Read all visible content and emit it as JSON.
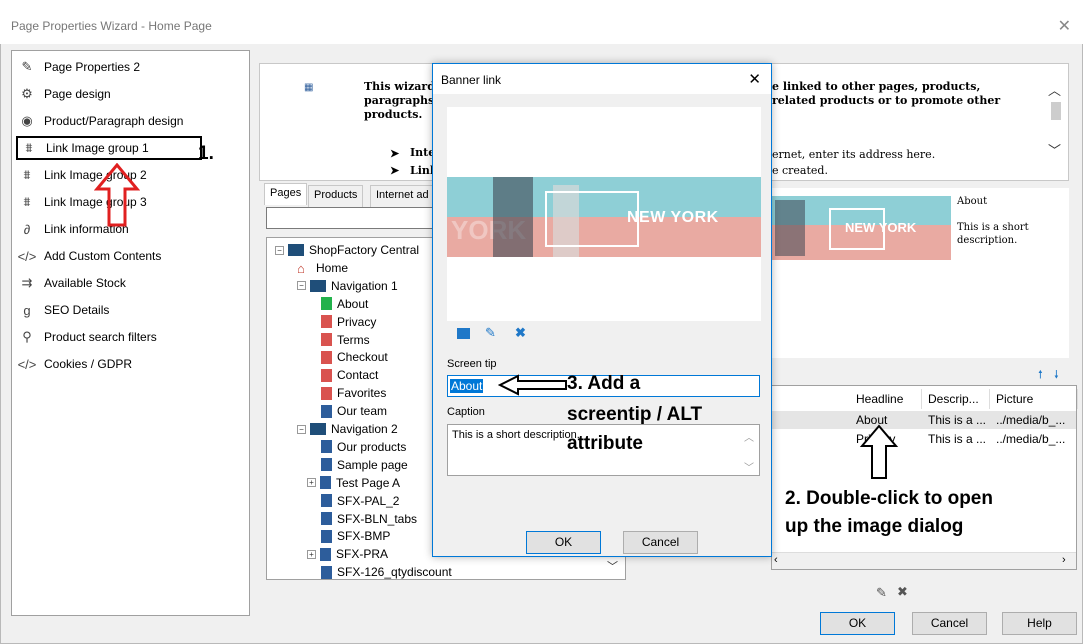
{
  "window": {
    "title": "Page Properties Wizard - Home Page",
    "close_glyph": "✕"
  },
  "left_nav": {
    "items": [
      {
        "label": "Page Properties 2",
        "icon": "pencil-icon",
        "glyph": "✎"
      },
      {
        "label": "Page design",
        "icon": "palette-icon",
        "glyph": "⚙"
      },
      {
        "label": "Product/Paragraph design",
        "icon": "eye-icon",
        "glyph": "◉"
      },
      {
        "label": "Link Image group 1",
        "icon": "sitemap-icon",
        "glyph": "⩩"
      },
      {
        "label": "Link Image group 2",
        "icon": "sitemap-icon",
        "glyph": "⩩"
      },
      {
        "label": "Link Image group 3",
        "icon": "sitemap-icon",
        "glyph": "⩩"
      },
      {
        "label": "Link information",
        "icon": "link-icon",
        "glyph": "∂"
      },
      {
        "label": "Add Custom Contents",
        "icon": "code-icon",
        "glyph": "</>"
      },
      {
        "label": "Available Stock",
        "icon": "stock-icon",
        "glyph": "⇉"
      },
      {
        "label": "SEO Details",
        "icon": "seo-icon",
        "glyph": "g"
      },
      {
        "label": "Product search filters",
        "icon": "search-icon",
        "glyph": "⚲"
      },
      {
        "label": "Cookies / GDPR",
        "icon": "code-icon",
        "glyph": "</>"
      }
    ]
  },
  "annotations": {
    "step1": "1.",
    "step2_line1": "2. Double-click to open",
    "step2_line2": "up the image dialog",
    "step3_line1": "3. Add a",
    "step3_line2": "screentip / ALT",
    "step3_line3": "attribute"
  },
  "wizard_info": {
    "intro_a": "This wizard",
    "intro_b": "paragraphs",
    "intro_c": "products.",
    "intro_right_a": "e linked to other pages, products,",
    "intro_right_b": "related products or to promote other",
    "bullet1": "Inte",
    "bullet2": "Link",
    "bullet1_right": "ernet, enter its address here.",
    "bullet2_right": "e created."
  },
  "tabs": [
    "Pages",
    "Products",
    "Internet ad"
  ],
  "tree": {
    "rows": [
      {
        "label": "ShopFactory Central",
        "type": "root"
      },
      {
        "label": "Home",
        "type": "home"
      },
      {
        "label": "Navigation 1",
        "type": "folder"
      },
      {
        "label": "About",
        "type": "green"
      },
      {
        "label": "Privacy",
        "type": "red"
      },
      {
        "label": "Terms",
        "type": "red"
      },
      {
        "label": "Checkout",
        "type": "red"
      },
      {
        "label": "Contact",
        "type": "red"
      },
      {
        "label": "Favorites",
        "type": "red"
      },
      {
        "label": "Our team",
        "type": "blue"
      },
      {
        "label": "Navigation 2",
        "type": "folder"
      },
      {
        "label": "Our products",
        "type": "blue"
      },
      {
        "label": "Sample page",
        "type": "blue"
      },
      {
        "label": "Test Page A",
        "type": "blue"
      },
      {
        "label": "SFX-PAL_2",
        "type": "blue"
      },
      {
        "label": "SFX-BLN_tabs",
        "type": "blue"
      },
      {
        "label": "SFX-BMP",
        "type": "blue"
      },
      {
        "label": "SFX-PRA",
        "type": "blue"
      },
      {
        "label": "SFX-126_qtydiscount",
        "type": "blue"
      }
    ]
  },
  "preview": {
    "banner_text": "NEW YORK",
    "headline": "About",
    "description": "This is a short description."
  },
  "grid": {
    "headers": [
      "Headline",
      "Descrip...",
      "Picture"
    ],
    "rows": [
      [
        "About",
        "This is a ...",
        "../media/b_..."
      ],
      [
        "Privacy",
        "This is a ...",
        "../media/b_..."
      ]
    ]
  },
  "dialog": {
    "title": "Banner link",
    "close_glyph": "✕",
    "banner_text": "NEW YORK",
    "screen_tip_label": "Screen tip",
    "screen_tip_value": "About",
    "caption_label": "Caption",
    "caption_value": "This is a short description.",
    "ok": "OK",
    "cancel": "Cancel"
  },
  "footer": {
    "ok": "OK",
    "cancel": "Cancel",
    "help": "Help"
  }
}
